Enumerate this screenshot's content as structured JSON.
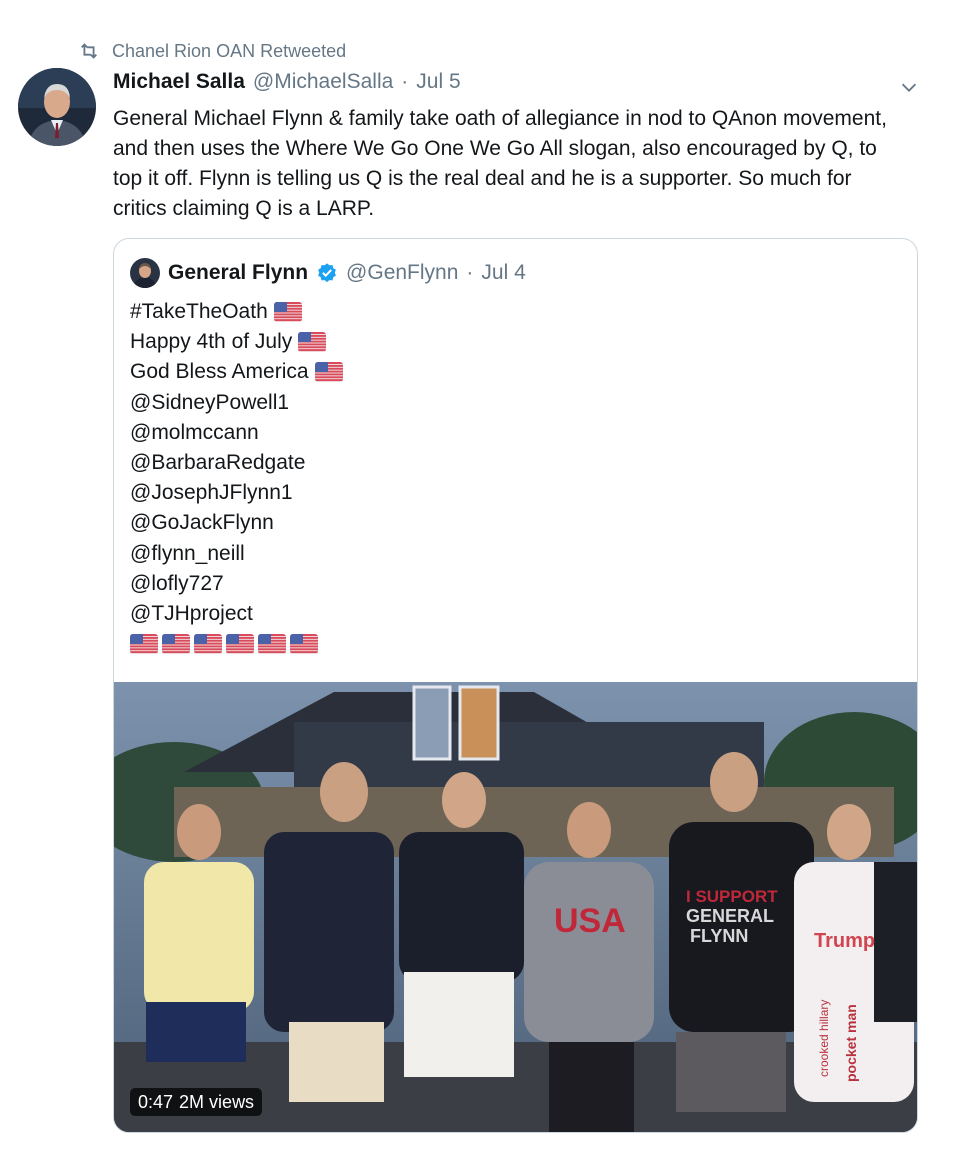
{
  "retweet": {
    "label": "Chanel Rion OAN Retweeted",
    "icon": "retweet-icon"
  },
  "tweet": {
    "author_name": "Michael Salla",
    "author_handle": "@MichaelSalla",
    "separator": "·",
    "date": "Jul 5",
    "text": "General Michael Flynn & family take oath of allegiance in nod to QAnon movement, and then uses the Where We Go One We Go All slogan, also encouraged by Q, to top it off. Flynn is telling us Q is the real deal and he is a supporter. So much for critics claiming Q is a LARP.",
    "menu_icon": "chevron-down-icon"
  },
  "quoted_tweet": {
    "author_name": "General Flynn",
    "author_handle": "@GenFlynn",
    "separator": "·",
    "date": "Jul 4",
    "verified_icon": "verified-badge-icon",
    "lines": [
      {
        "text": "#TakeTheOath",
        "flag": true
      },
      {
        "text": "Happy 4th of July",
        "flag": true
      },
      {
        "text": "God Bless America",
        "flag": true
      },
      {
        "text": "@SidneyPowell1",
        "flag": false
      },
      {
        "text": "@molmccann",
        "flag": false
      },
      {
        "text": "@BarbaraRedgate",
        "flag": false
      },
      {
        "text": "@JosephJFlynn1",
        "flag": false
      },
      {
        "text": "@GoJackFlynn",
        "flag": false
      },
      {
        "text": "@flynn_neill",
        "flag": false
      },
      {
        "text": "@lofly727",
        "flag": false
      },
      {
        "text": "@TJHproject",
        "flag": false
      }
    ],
    "flag_emoji_count": 6,
    "flag_icon": "us-flag-icon",
    "video": {
      "duration": "0:47",
      "views": "2M views",
      "shirt_text_1": "USA",
      "shirt_text_2": "I SUPPORT",
      "shirt_text_3": "GENERAL",
      "shirt_text_4": "FLYNN",
      "shirt_text_5": "Trump",
      "shirt_text_6": "crooked hillary",
      "shirt_text_7": "pocket man"
    }
  },
  "colors": {
    "text": "#14171a",
    "muted": "#657786",
    "verified": "#1da1f2",
    "border": "#ccd6dd"
  }
}
